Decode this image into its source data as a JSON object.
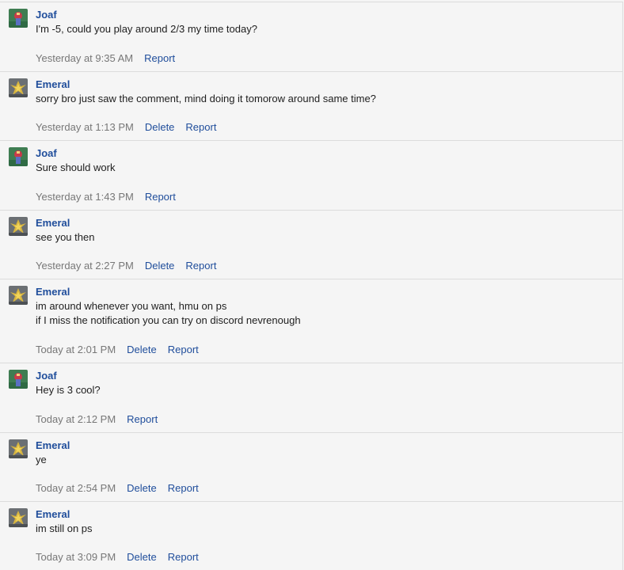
{
  "comments": [
    {
      "author": "Joaf",
      "avatar": "joaf-avatar",
      "lines": [
        "I'm -5, could you play around 2/3 my time today?"
      ],
      "time": "Yesterday at 9:35 AM",
      "actions": [
        "Report"
      ]
    },
    {
      "author": "Emeral",
      "avatar": "emeral-avatar",
      "lines": [
        "sorry bro just saw the comment, mind doing it tomorow around same time?"
      ],
      "time": "Yesterday at 1:13 PM",
      "actions": [
        "Delete",
        "Report"
      ]
    },
    {
      "author": "Joaf",
      "avatar": "joaf-avatar",
      "lines": [
        "Sure should work"
      ],
      "time": "Yesterday at 1:43 PM",
      "actions": [
        "Report"
      ]
    },
    {
      "author": "Emeral",
      "avatar": "emeral-avatar",
      "lines": [
        "see you then"
      ],
      "time": "Yesterday at 2:27 PM",
      "actions": [
        "Delete",
        "Report"
      ]
    },
    {
      "author": "Emeral",
      "avatar": "emeral-avatar",
      "lines": [
        "im around whenever you want, hmu on ps",
        "if I miss the notification you can try on discord nevrenough"
      ],
      "time": "Today at 2:01 PM",
      "actions": [
        "Delete",
        "Report"
      ]
    },
    {
      "author": "Joaf",
      "avatar": "joaf-avatar",
      "lines": [
        "Hey is 3 cool?"
      ],
      "time": "Today at 2:12 PM",
      "actions": [
        "Report"
      ]
    },
    {
      "author": "Emeral",
      "avatar": "emeral-avatar",
      "lines": [
        "ye"
      ],
      "time": "Today at 2:54 PM",
      "actions": [
        "Delete",
        "Report"
      ]
    },
    {
      "author": "Emeral",
      "avatar": "emeral-avatar",
      "lines": [
        "im still on ps"
      ],
      "time": "Today at 3:09 PM",
      "actions": [
        "Delete",
        "Report"
      ]
    }
  ],
  "colors": {
    "link": "#1f4d9b",
    "timestamp": "#777777",
    "background": "#f5f5f5",
    "divider": "#dcdcdc"
  }
}
